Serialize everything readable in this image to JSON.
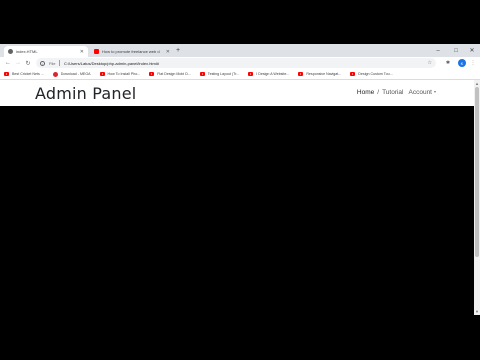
{
  "browser": {
    "tabs": [
      {
        "title": "index.HTML",
        "active": true
      },
      {
        "title": "How to promote freelance web d",
        "active": false
      }
    ],
    "new_tab": "+",
    "window_controls": {
      "minimize": "–",
      "maximize": "□",
      "close": "✕"
    },
    "address": {
      "scheme": "File",
      "url": "C:/Users/Latus/Desktop/php-admin-panel/index.html#"
    },
    "avatar_initial": "K"
  },
  "bookmarks": [
    {
      "label": "Best Cricket Nets ..."
    },
    {
      "label": "Download - MEGA"
    },
    {
      "label": "How To Install Pho..."
    },
    {
      "label": "Flat Design Mobi D..."
    },
    {
      "label": "Testing Layout (Tr..."
    },
    {
      "label": "I Design A Website..."
    },
    {
      "label": "Responsive Navigat..."
    },
    {
      "label": "Design Custom Tou..."
    }
  ],
  "page": {
    "brand": "Admin Panel",
    "nav": {
      "home": "Home",
      "separator": "/",
      "tutorial": "Tutorial",
      "account": "Account"
    }
  }
}
